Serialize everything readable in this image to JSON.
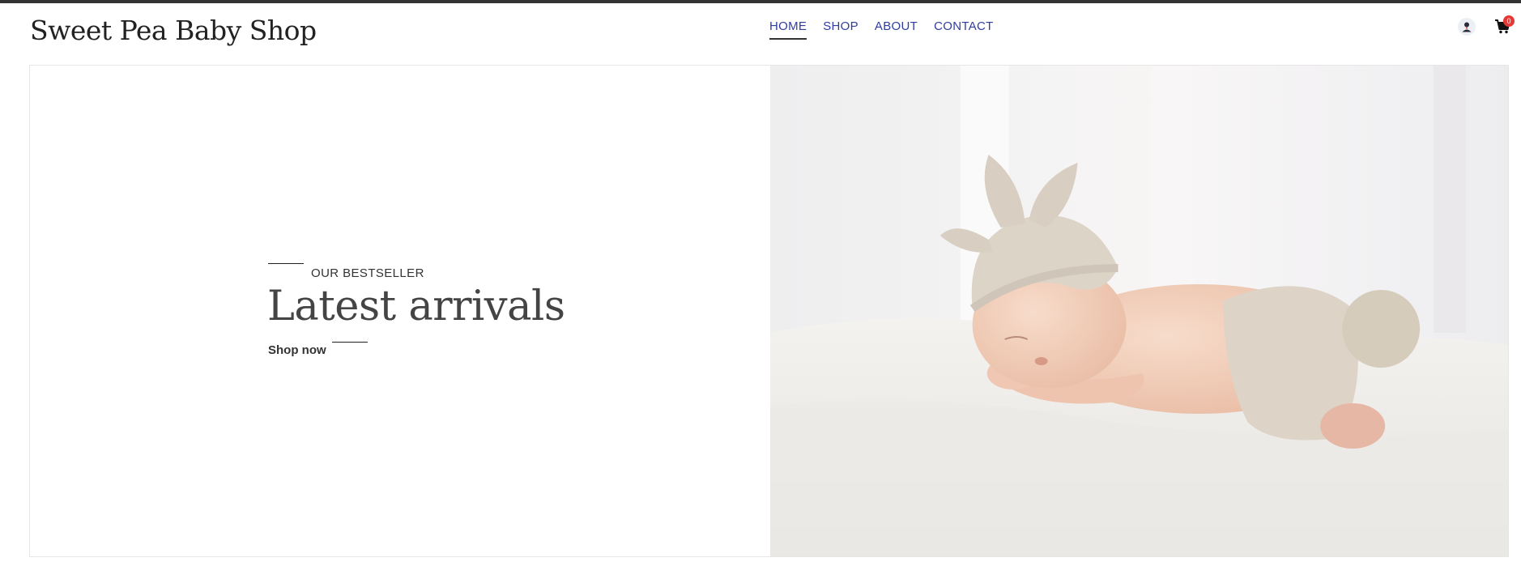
{
  "header": {
    "logo": "Sweet Pea Baby Shop",
    "nav": [
      {
        "label": "HOME",
        "active": true
      },
      {
        "label": "SHOP",
        "active": false
      },
      {
        "label": "ABOUT",
        "active": false
      },
      {
        "label": "CONTACT",
        "active": false
      }
    ],
    "account_icon": "user-avatar-icon",
    "cart_icon": "shopping-cart-icon",
    "cart_count": "0"
  },
  "hero": {
    "eyebrow": "OUR BESTSELLER",
    "title": "Latest arrivals",
    "cta": "Shop now",
    "image_subject": "sleeping baby in knitted bunny hat on white fleece blanket"
  },
  "colors": {
    "nav_link": "#2f3e9e",
    "top_bar": "#333333",
    "badge": "#e53935",
    "text_dark": "#333333"
  }
}
